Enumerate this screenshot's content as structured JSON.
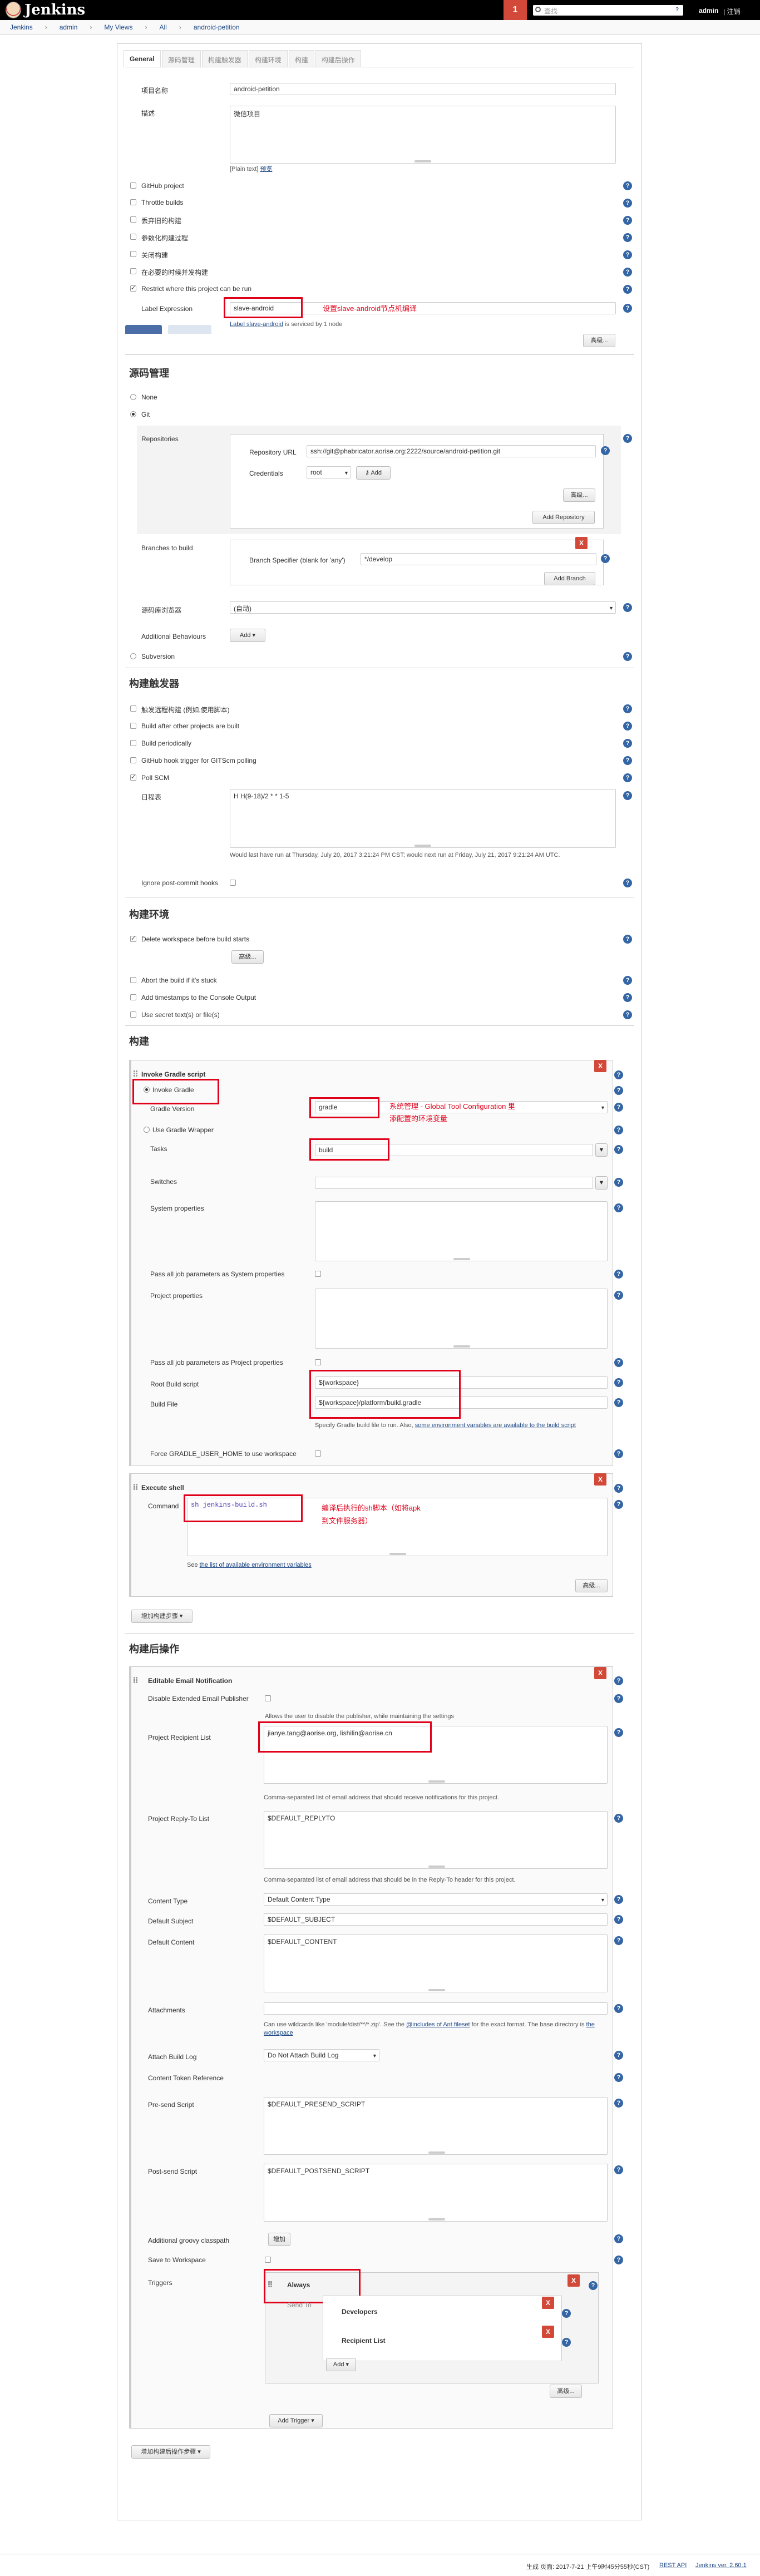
{
  "header": {
    "app_title": "Jenkins",
    "notification_count": "1",
    "search_placeholder": "查找",
    "help": "?",
    "user": "admin",
    "logout": "| 注销"
  },
  "breadcrumb": [
    "Jenkins",
    "admin",
    "My Views",
    "All",
    "android-petition"
  ],
  "tabs": [
    "General",
    "源码管理",
    "构建触发器",
    "构建环境",
    "构建",
    "构建后操作"
  ],
  "general": {
    "project_name_label": "项目名称",
    "project_name": "android-petition",
    "description_label": "描述",
    "description": "微信项目",
    "plain_text": "[Plain text]",
    "preview": "预览",
    "options": [
      {
        "label": "GitHub project",
        "checked": false
      },
      {
        "label": "Throttle builds",
        "checked": false
      },
      {
        "label": "丢弃旧的构建",
        "checked": false
      },
      {
        "label": "参数化构建过程",
        "checked": false
      },
      {
        "label": "关闭构建",
        "checked": false
      },
      {
        "label": "在必要的时候并发构建",
        "checked": false
      },
      {
        "label": "Restrict where this project can be run",
        "checked": true
      }
    ],
    "label_expression_label": "Label Expression",
    "label_expression": "slave-android",
    "label_annotation": "设置slave-android节点机编译",
    "label_info_link": "Label slave-android",
    "label_info_rest": " is serviced by 1 node",
    "advanced": "高级..."
  },
  "scm": {
    "title": "源码管理",
    "none": "None",
    "git": "Git",
    "repositories_label": "Repositories",
    "repo_url_label": "Repository URL",
    "repo_url": "ssh://git@phabricator.aorise.org:2222/source/android-petition.git",
    "credentials_label": "Credentials",
    "credentials_value": "root",
    "add_button": "Add",
    "advanced": "高级...",
    "add_repository": "Add Repository",
    "branches_label": "Branches to build",
    "branch_specifier_label": "Branch Specifier (blank for 'any')",
    "branch_specifier": "*/develop",
    "add_branch": "Add Branch",
    "browser_label": "源码库浏览器",
    "browser_value": "(自动)",
    "additional_label": "Additional Behaviours",
    "add": "Add",
    "subversion": "Subversion"
  },
  "triggers": {
    "title": "构建触发器",
    "options": [
      {
        "label": "触发远程构建 (例如,使用脚本)",
        "checked": false
      },
      {
        "label": "Build after other projects are built",
        "checked": false
      },
      {
        "label": "Build periodically",
        "checked": false
      },
      {
        "label": "GitHub hook trigger for GITScm polling",
        "checked": false
      },
      {
        "label": "Poll SCM",
        "checked": true
      }
    ],
    "schedule_label": "日程表",
    "schedule": "H H(9-18)/2 * * 1-5",
    "schedule_note": "Would last have run at Thursday, July 20, 2017 3:21:24 PM CST; would next run at Friday, July 21, 2017 9:21:24 AM UTC.",
    "ignore_hooks": "Ignore post-commit hooks"
  },
  "env": {
    "title": "构建环境",
    "delete_ws": "Delete workspace before build starts",
    "advanced": "高级...",
    "options": [
      {
        "label": "Abort the build if it's stuck",
        "checked": false
      },
      {
        "label": "Add timestamps to the Console Output",
        "checked": false
      },
      {
        "label": "Use secret text(s) or file(s)",
        "checked": false
      }
    ]
  },
  "build": {
    "title": "构建",
    "gradle_title": "Invoke Gradle script",
    "invoke_gradle": "Invoke Gradle",
    "gradle_version_label": "Gradle Version",
    "gradle_version": "gradle",
    "gradle_annotation_line1": "系统管理 - Global Tool Configuration 里",
    "gradle_annotation_line2": "添配置的环境变量",
    "use_wrapper": "Use Gradle Wrapper",
    "tasks_label": "Tasks",
    "tasks": "build",
    "switches_label": "Switches",
    "system_props_label": "System properties",
    "pass_system": "Pass all job parameters as System properties",
    "project_props_label": "Project properties",
    "pass_project": "Pass all job parameters as Project properties",
    "root_script_label": "Root Build script",
    "root_script": "${workspace}",
    "build_file_label": "Build File",
    "build_file": "${workspace}/platform/build.gradle",
    "build_file_note": "Specify Gradle build file to run. Also, ",
    "build_file_link": "some environment variables are available to the build script",
    "force_home": "Force GRADLE_USER_HOME to use workspace",
    "shell_title": "Execute shell",
    "command_label": "Command",
    "command": "sh jenkins-build.sh",
    "shell_annotation_line1": "编译后执行的sh脚本（如将apk",
    "shell_annotation_line2": "到文件服务器）",
    "see_list_prefix": "See ",
    "see_list_link": "the list of available environment variables",
    "advanced": "高级...",
    "add_step": "增加构建步骤"
  },
  "post": {
    "title": "构建后操作",
    "email_title": "Editable Email Notification",
    "disable_publisher": "Disable Extended Email Publisher",
    "disable_note": "Allows the user to disable the publisher, while maintaining the settings",
    "recipients_label": "Project Recipient List",
    "recipients": "jianye.tang@aorise.org, lishilin@aorise.cn",
    "recipients_note": "Comma-separated list of email address that should receive notifications for this project.",
    "reply_to_label": "Project Reply-To List",
    "reply_to": "$DEFAULT_REPLYTO",
    "reply_to_note": "Comma-separated list of email address that should be in the Reply-To header for this project.",
    "content_type_label": "Content Type",
    "content_type": "Default Content Type",
    "subject_label": "Default Subject",
    "subject": "$DEFAULT_SUBJECT",
    "content_label": "Default Content",
    "content": "$DEFAULT_CONTENT",
    "attachments_label": "Attachments",
    "attachments_note_1": "Can use wildcards like 'module/dist/**/*.zip'. See the ",
    "attachments_note_link1": "@includes of Ant fileset",
    "attachments_note_2": " for the exact format. The base directory is ",
    "attachments_note_link2": "the workspace",
    "attach_log_label": "Attach Build Log",
    "attach_log": "Do Not Attach Build Log",
    "token_ref": "Content Token Reference",
    "presend_label": "Pre-send Script",
    "presend": "$DEFAULT_PRESEND_SCRIPT",
    "postsend_label": "Post-send Script",
    "postsend": "$DEFAULT_POSTSEND_SCRIPT",
    "groovy_label": "Additional groovy classpath",
    "groovy_add": "增加",
    "save_ws": "Save to Workspace",
    "triggers_label": "Triggers",
    "trigger_always": "Always",
    "send_to": "Send To",
    "developers": "Developers",
    "recipient_list": "Recipient List",
    "add": "Add",
    "advanced": "高级...",
    "add_trigger": "Add Trigger",
    "add_post_step": "增加构建后操作步骤"
  },
  "footer": {
    "generated": "生成 页面: 2017-7-21 上午9时45分55秒(CST)",
    "rest_api": "REST API",
    "version": "Jenkins ver. 2.60.1"
  },
  "colors": {
    "accent": "#d24939",
    "annotation": "#e0001a",
    "help": "#3465a4"
  }
}
